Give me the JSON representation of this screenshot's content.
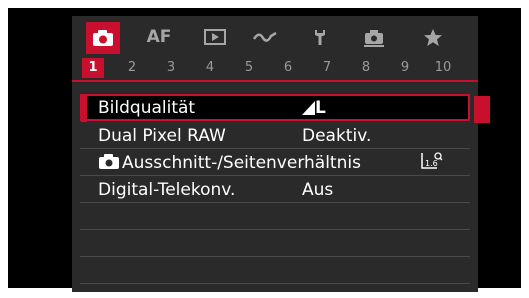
{
  "categories": [
    {
      "name": "camera-tab",
      "icon": "camera-icon",
      "label": ""
    },
    {
      "name": "af-tab",
      "icon": "",
      "label": "AF"
    },
    {
      "name": "playback-tab",
      "icon": "playback-icon",
      "label": ""
    },
    {
      "name": "wireless-tab",
      "icon": "wireless-icon",
      "label": ""
    },
    {
      "name": "setup-tab",
      "icon": "wrench-icon",
      "label": ""
    },
    {
      "name": "custom-tab",
      "icon": "custom-camera-icon",
      "label": ""
    },
    {
      "name": "mymenu-tab",
      "icon": "star-icon",
      "label": ""
    }
  ],
  "numbers": [
    "1",
    "2",
    "3",
    "4",
    "5",
    "6",
    "7",
    "8",
    "9",
    "10"
  ],
  "active_number": "1",
  "rows": [
    {
      "label": "Bildqualität",
      "value": "L",
      "selected": true
    },
    {
      "label": "Dual Pixel RAW",
      "value": "Deaktiv.",
      "selected": false
    },
    {
      "label": "Ausschnitt-/Seitenverhältnis",
      "value": "1.6",
      "selected": false
    },
    {
      "label": "Digital-Telekonv.",
      "value": "Aus",
      "selected": false
    }
  ],
  "colors": {
    "accent": "#c8102e",
    "background": "#2a2a2a",
    "screen": "#000000"
  }
}
